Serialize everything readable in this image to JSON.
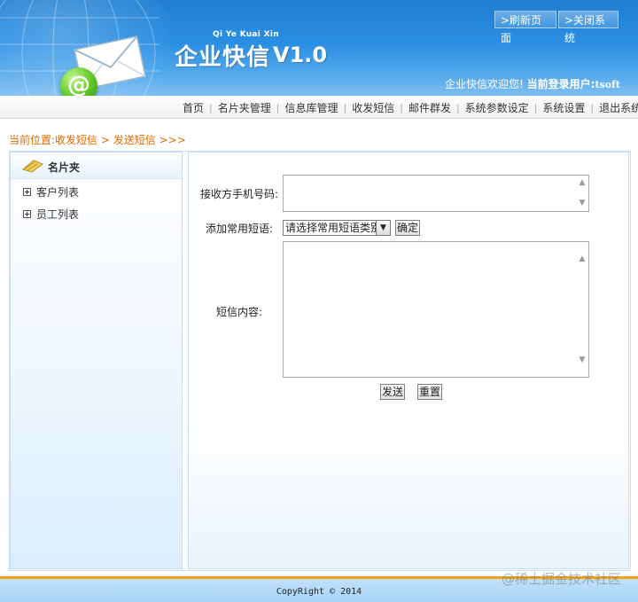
{
  "header": {
    "pinyin": "Qi Ye Kuai Xin",
    "brand": "企业快信",
    "version": "V1.0",
    "refresh_label": ">刷新页面",
    "close_label": ">关闭系统",
    "welcome_text": "企业快信欢迎您!",
    "current_user_label": "当前登录用户:",
    "username": "tsoft"
  },
  "nav": {
    "items": [
      {
        "label": "首页"
      },
      {
        "label": "名片夹管理"
      },
      {
        "label": "信息库管理"
      },
      {
        "label": "收发短信"
      },
      {
        "label": "邮件群发"
      },
      {
        "label": "系统参数设定"
      },
      {
        "label": "系统设置"
      },
      {
        "label": "退出系统"
      }
    ]
  },
  "breadcrumb": {
    "prefix": "当前位置:",
    "items": [
      "收发短信",
      "发送短信"
    ],
    "separator": ">",
    "tail": ">>>"
  },
  "sidebar": {
    "title": "名片夹",
    "items": [
      {
        "label": "客户列表"
      },
      {
        "label": "员工列表"
      }
    ]
  },
  "form": {
    "phone_label": "接收方手机号码:",
    "phone_value": "",
    "common_label": "添加常用短语:",
    "select_value": "请选择常用短语类别",
    "confirm_label": "确定",
    "content_label": "短信内容:",
    "content_value": "",
    "send_label": "发送",
    "reset_label": "重置"
  },
  "footer": {
    "copyright": "CopyRight © 2014"
  },
  "watermark": "@稀土掘金技术社区"
}
